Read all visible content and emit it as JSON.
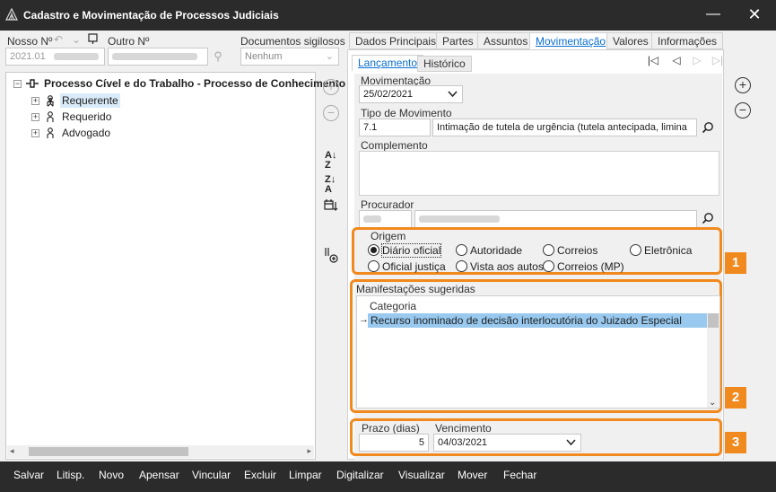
{
  "window": {
    "title": "Cadastro e Movimentação de Processos Judiciais",
    "minimize_glyph": "—",
    "close_glyph": "✕"
  },
  "header": {
    "nosso_no_label": "Nosso Nº",
    "nosso_no_value": "2021.01",
    "outro_no_label": "Outro Nº",
    "documentos_label": "Documentos sigilosos",
    "documentos_value": "Nenhum"
  },
  "tree": {
    "root": "Processo Cível e do Trabalho - Processo de Conhecimento",
    "items": [
      {
        "label": "Requerente"
      },
      {
        "label": "Requerido"
      },
      {
        "label": "Advogado"
      }
    ]
  },
  "tabs": [
    {
      "label": "Dados Principais"
    },
    {
      "label": "Partes"
    },
    {
      "label": "Assuntos"
    },
    {
      "label": "Movimentação"
    },
    {
      "label": "Valores"
    },
    {
      "label": "Informações"
    }
  ],
  "subtabs": [
    {
      "label": "Lançamento"
    },
    {
      "label": "Histórico"
    }
  ],
  "form": {
    "movimentacao_label": "Movimentação",
    "movimentacao_value": "25/02/2021",
    "tipo_label": "Tipo de Movimento",
    "tipo_code": "7.1",
    "tipo_desc": "Intimação de tutela de urgência (tutela antecipada, limina",
    "complemento_label": "Complemento",
    "procurador_label": "Procurador"
  },
  "origem": {
    "label": "Origem",
    "options": [
      {
        "label": "Diário oficial",
        "selected": true
      },
      {
        "label": "Autoridade",
        "selected": false
      },
      {
        "label": "Correios",
        "selected": false
      },
      {
        "label": "Eletrônica",
        "selected": false
      },
      {
        "label": "Oficial justiça",
        "selected": false
      },
      {
        "label": "Vista aos autos",
        "selected": false
      },
      {
        "label": "Correios (MP)",
        "selected": false
      }
    ]
  },
  "manifestacoes": {
    "label": "Manifestações sugeridas",
    "column_header": "Categoria",
    "rows": [
      {
        "categoria": "Recurso inominado de decisão interlocutória do Juizado Especial",
        "selected": true
      }
    ]
  },
  "prazo": {
    "prazo_label": "Prazo (dias)",
    "prazo_value": "5",
    "vencimento_label": "Vencimento",
    "vencimento_value": "04/03/2021"
  },
  "badges": [
    "1",
    "2",
    "3"
  ],
  "bottom_bar": [
    {
      "label": "Salvar"
    },
    {
      "label": "Litisp."
    },
    {
      "label": "Novo"
    },
    {
      "label": "Apensar"
    },
    {
      "label": "Vincular"
    },
    {
      "label": "Excluir"
    },
    {
      "label": "Limpar"
    },
    {
      "label": "Digitalizar"
    },
    {
      "label": "Visualizar"
    },
    {
      "label": "Mover"
    },
    {
      "label": "Fechar"
    }
  ],
  "colors": {
    "titlebar": "#2b2b2b",
    "accent": "#0a6fd1",
    "highlight": "#f0891e",
    "selection": "#99c9ef"
  }
}
